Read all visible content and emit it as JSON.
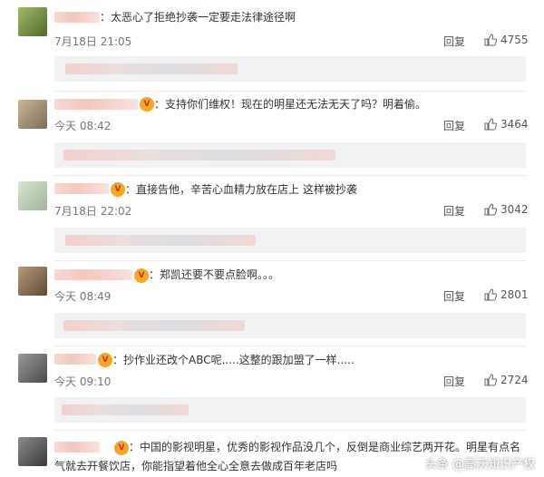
{
  "comments": [
    {
      "text": "：太恶心了拒绝抄袭一定要走法律途径啊",
      "time": "7月18日 21:05",
      "reply": "回复",
      "likes": "4755"
    },
    {
      "text": "：支持你们维权！现在的明星还无法无天了吗？明着偷。",
      "time": "今天 08:42",
      "reply": "回复",
      "likes": "3464"
    },
    {
      "text": "：直接告他，辛苦心血精力放在店上 这样被抄袭",
      "time": "7月18日 22:02",
      "reply": "回复",
      "likes": "3042"
    },
    {
      "text": "：郑凯还要不要点脸啊。。。",
      "time": "今天 08:49",
      "reply": "回复",
      "likes": "2801"
    },
    {
      "text": "：抄作业还改个ABC呢.....这整的跟加盟了一样.....",
      "time": "今天 09:10",
      "reply": "回复",
      "likes": "2724"
    },
    {
      "text": "：中国的影视明星，优秀的影视作品没几个，反倒是商业综艺两开花。明星有点名",
      "text2": "气就去开餐饮店，你能指望着他全心全意去做成百年老店吗"
    }
  ],
  "watermark": "头条 @高沃知识产权"
}
